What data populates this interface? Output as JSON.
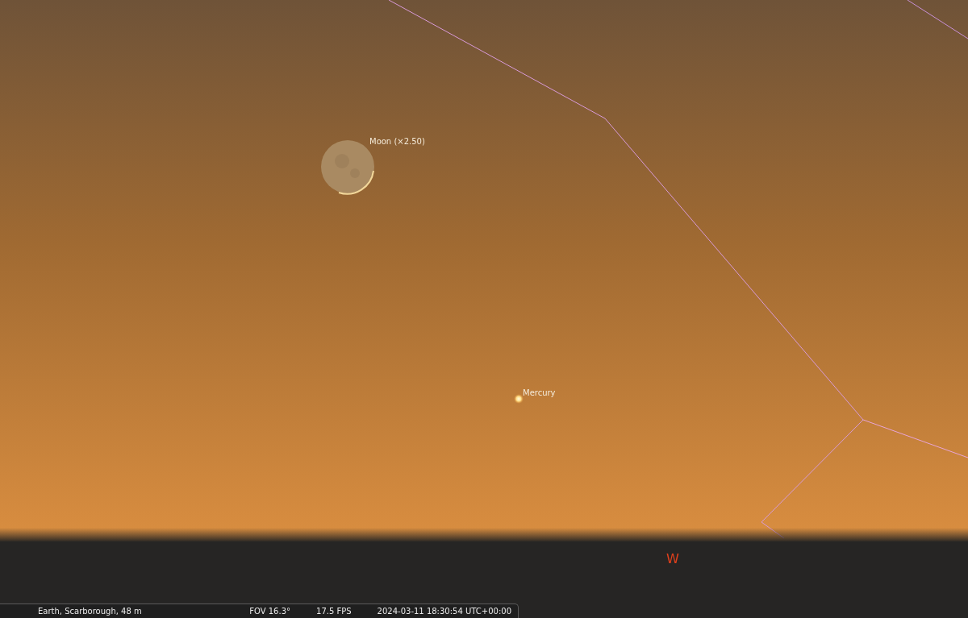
{
  "sky_objects": [
    {
      "kind": "moon",
      "label": "Moon (×2.50)"
    },
    {
      "kind": "planet",
      "label": "Mercury"
    }
  ],
  "cardinal_point": {
    "label": "W"
  },
  "status_bar": {
    "location": "Earth, Scarborough, 48 m",
    "fov": "FOV 16.3°",
    "fps": "17.5 FPS",
    "datetime": "2024-03-11 18:30:54 UTC+00:00"
  }
}
